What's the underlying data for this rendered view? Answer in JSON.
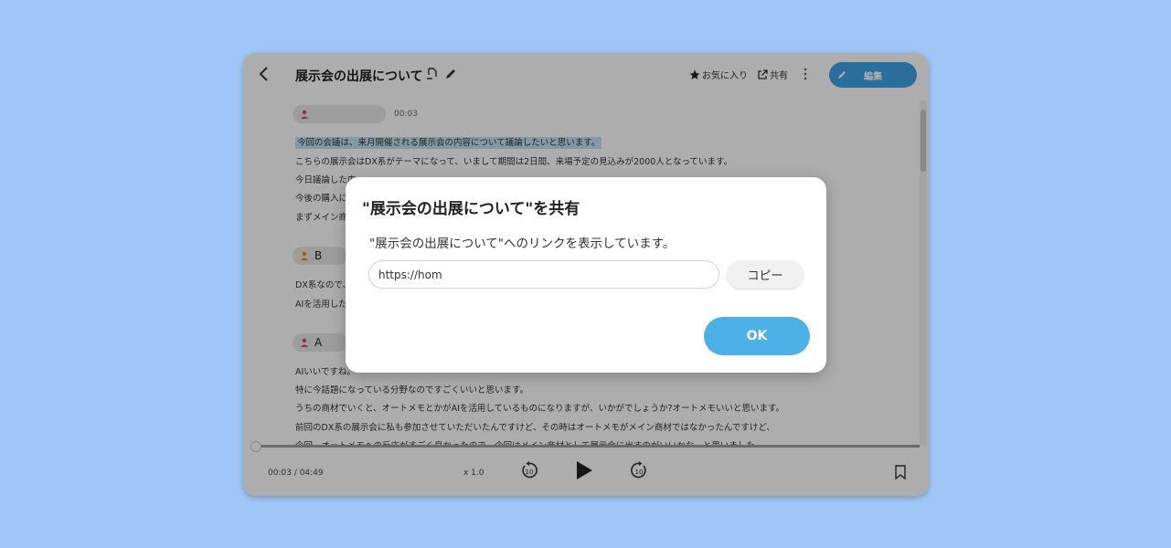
{
  "header": {
    "title": "展示会の出展について",
    "favorite_label": "お気に入り",
    "share_label": "共有",
    "edit_label": "編集"
  },
  "transcript": {
    "blocks": [
      {
        "speaker": "",
        "time": "00:03",
        "lines": [
          "今回の会議は、来月開催される展示会の内容について議論したいと思います。",
          "こちらの展示会はDX系がテーマになって、いまして期間は2日間、来場予定の見込みが2000人となっています。",
          "今日議論した内",
          "今後の購入に",
          "まずメイン商"
        ]
      },
      {
        "speaker": "B",
        "lines": [
          "DX系なので、",
          "AIを活用した"
        ]
      },
      {
        "speaker": "A",
        "lines": [
          "AIいいですね。",
          "特に今話題になっている分野なのですごくいいと思います。",
          "うちの商材でいくと、オートメモとかがAIを活用しているものになりますが、いかがでしょうか?オートメモいいと思います。",
          "前回のDX系の展示会に私も参加させていただいたんですけど、その時はオートメモがメイン商材ではなかったんですけど、",
          "今回、オートメモへの反応がすごく良かったので、今回はメイン商材として展示会に出すのがいいかな、と思いました。"
        ]
      }
    ]
  },
  "player": {
    "time_display": "00:03 / 04:49",
    "speed": "x 1.0",
    "progress": 0.01
  },
  "dialog": {
    "title": "\"展示会の出展について\"を共有",
    "description": "\"展示会の出展について\"へのリンクを表示しています。",
    "url_value": "https://hom",
    "copy_label": "コピー",
    "ok_label": "OK"
  },
  "colors": {
    "background": "#9fc6f7",
    "accent": "#4db1e8",
    "speaker_red": "#e2456b",
    "speaker_orange": "#f08a24"
  }
}
